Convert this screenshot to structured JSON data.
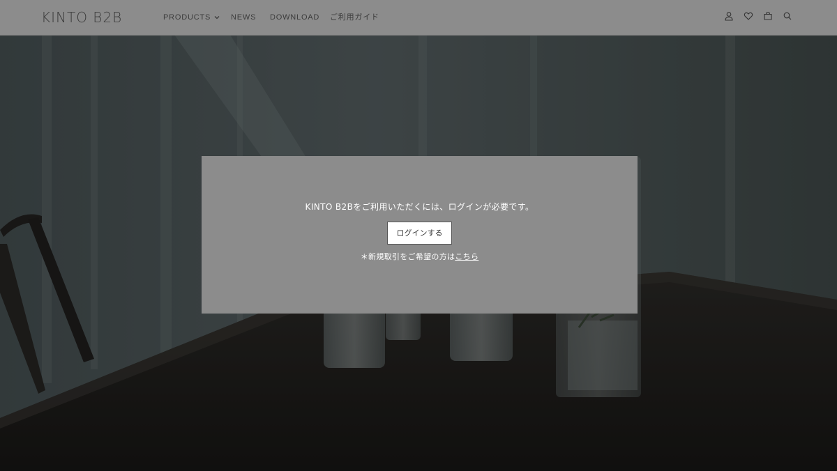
{
  "header": {
    "logo": "KINTO B2B",
    "nav": [
      {
        "label": "PRODUCTS",
        "has_dropdown": true
      },
      {
        "label": "NEWS"
      },
      {
        "label": "DOWNLOAD"
      },
      {
        "label": "ご利用ガイド"
      }
    ],
    "icons": [
      "user-icon",
      "heart-icon",
      "cart-icon",
      "search-icon"
    ]
  },
  "modal": {
    "message": "KINTO B2Bをご利用いただくには、ログインが必要です。",
    "login_button": "ログインする",
    "note_prefix": "＊新規取引をご希望の方は",
    "note_link": "こちら"
  },
  "colors": {
    "header_bg": "#8c8c8c",
    "modal_bg": "#8c8c8c",
    "text_dark": "#3b3b3b",
    "text_light": "#ffffff"
  }
}
